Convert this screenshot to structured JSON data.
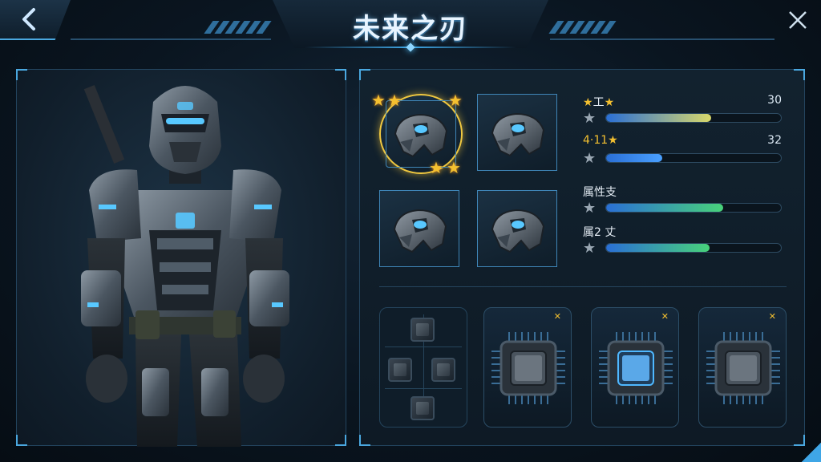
{
  "header": {
    "title": "未来之刃",
    "back_icon": "back-chevron-icon",
    "close_icon": "close-icon"
  },
  "equipment": {
    "slots": [
      {
        "id": "armor-1",
        "selected": true,
        "stars": 5
      },
      {
        "id": "armor-2",
        "selected": false
      },
      {
        "id": "armor-3",
        "selected": false
      },
      {
        "id": "armor-4",
        "selected": false
      }
    ]
  },
  "stats": [
    {
      "label_prefix": "★",
      "label_text": "工",
      "label_suffix": "★",
      "value": "30",
      "level": 0.6,
      "color_from": "#2a6fd6",
      "color_to": "#d8d86a"
    },
    {
      "label_prefix": "",
      "label_text": "4·11",
      "label_suffix": "★",
      "value": "32",
      "level": 0.32,
      "color_from": "#2a6fd6",
      "color_to": "#4aa0ff"
    },
    {
      "label_prefix": "",
      "label_text": "属性支",
      "label_suffix": "",
      "value": "",
      "level": 0.67,
      "color_from": "#2a6fd6",
      "color_to": "#48d27a"
    },
    {
      "label_prefix": "",
      "label_text": "属2 丈",
      "label_suffix": "",
      "value": "",
      "level": 0.59,
      "color_from": "#2a6fd6",
      "color_to": "#48d27a"
    }
  ],
  "modules": [
    {
      "id": "module-1",
      "highlighted": false,
      "marker": "✕"
    },
    {
      "id": "module-2",
      "highlighted": true,
      "marker": "✕"
    },
    {
      "id": "module-3",
      "highlighted": false,
      "marker": "✕"
    }
  ],
  "colors": {
    "accent": "#4aa8e0",
    "gold": "#f4c030",
    "panel": "#12222f"
  }
}
